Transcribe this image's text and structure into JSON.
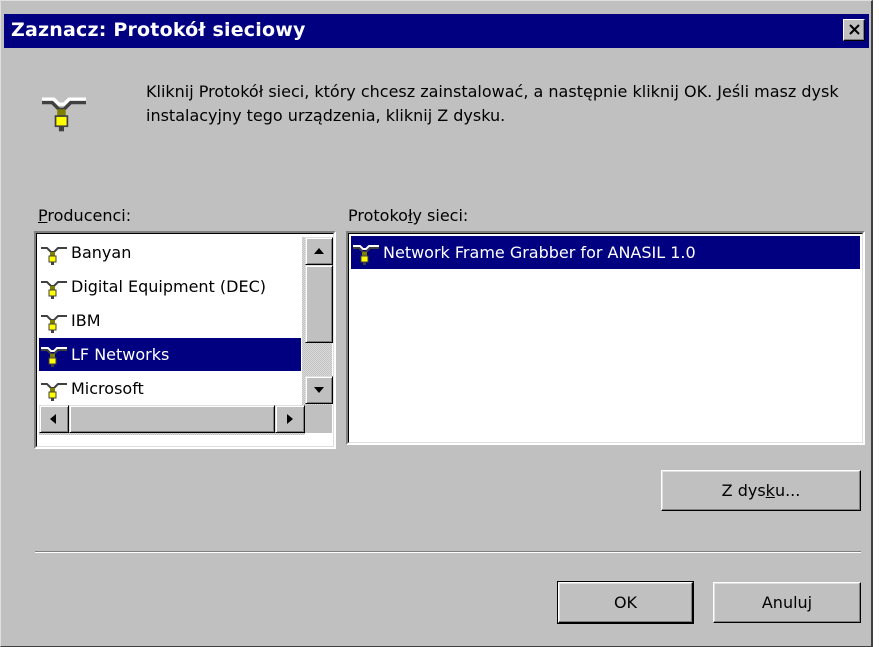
{
  "window": {
    "title": "Zaznacz: Protokół sieciowy"
  },
  "header": {
    "description": "Kliknij Protokół sieci, który chcesz zainstalować, a następnie kliknij OK. Jeśli masz dysk instalacyjny tego urządzenia, kliknij Z dysku.",
    "icon": "network-protocol-icon"
  },
  "manufacturers": {
    "label_prefix": "",
    "label_accel": "P",
    "label_rest": "roducenci:",
    "items": [
      {
        "label": "Banyan",
        "icon": "network-protocol-icon",
        "selected": false
      },
      {
        "label": "Digital Equipment (DEC)",
        "icon": "network-protocol-icon",
        "selected": false
      },
      {
        "label": "IBM",
        "icon": "network-protocol-icon",
        "selected": false
      },
      {
        "label": "LF Networks",
        "icon": "network-protocol-icon",
        "selected": true
      },
      {
        "label": "Microsoft",
        "icon": "network-protocol-icon",
        "selected": false
      }
    ]
  },
  "protocols": {
    "label_prefix": "Protoko",
    "label_accel": "ł",
    "label_rest": "y sieci:",
    "items": [
      {
        "label": "Network Frame Grabber for ANASIL 1.0",
        "icon": "network-protocol-icon",
        "selected": true
      }
    ]
  },
  "buttons": {
    "have_disk_prefix": "Z dys",
    "have_disk_accel": "k",
    "have_disk_rest": "u...",
    "ok": "OK",
    "cancel": "Anuluj"
  },
  "colors": {
    "face": "#c0c0c0",
    "title_bar": "#000080",
    "selection": "#000080"
  }
}
